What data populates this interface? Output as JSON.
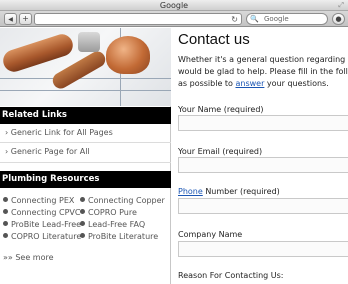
{
  "window": {
    "title": "Google"
  },
  "toolbar": {
    "back_label": "◀",
    "add_label": "+",
    "search_placeholder": "Google"
  },
  "sidebar": {
    "related_heading": "Related Links",
    "related_links": [
      "› Generic Link for All Pages",
      "› Generic Page for All"
    ],
    "resources_heading": "Plumbing Resources",
    "resources": [
      "Connecting PEX",
      "Connecting Copper",
      "Connecting CPVC",
      "COPRO Pure",
      "ProBite Lead-Free",
      "Lead-Free FAQ",
      "COPRO Literature",
      "ProBite Literature"
    ],
    "see_more": "»» See more"
  },
  "main": {
    "title": "Contact us",
    "intro_line1": "Whether it's a general question regarding our",
    "intro_line2": "would be glad to help.  Please fill in the followi",
    "intro_line3_pre": "as possible to ",
    "intro_link": "answer",
    "intro_line3_post": " your questions.",
    "form": {
      "name_label": "Your Name (required)",
      "email_label": "Your Email (required)",
      "phone_link": "Phone",
      "phone_label_rest": " Number (required)",
      "company_label": "Company Name",
      "reason_label": "Reason For Contacting Us:"
    }
  }
}
